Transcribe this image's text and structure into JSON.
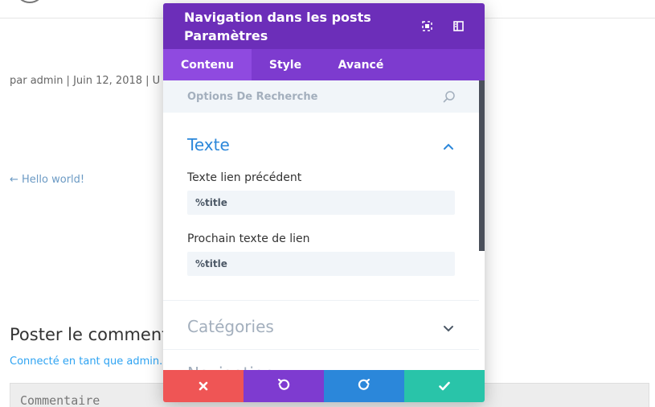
{
  "background": {
    "meta": "par admin | Juin 12, 2018 | U",
    "prev_link": "← Hello world!",
    "comment_heading": "Poster le comment",
    "logged_in": "Connecté en tant que admin.",
    "comment_placeholder": "Commentaire"
  },
  "modal": {
    "title": "Navigation dans les posts Paramètres",
    "header_icons": [
      "expand-icon",
      "split-view-icon"
    ],
    "tabs": [
      {
        "label": "Contenu",
        "active": true
      },
      {
        "label": "Style",
        "active": false
      },
      {
        "label": "Avancé",
        "active": false
      }
    ],
    "search": {
      "placeholder": "Options De Recherche"
    },
    "sections": {
      "texte": {
        "title": "Texte",
        "fields": [
          {
            "label": "Texte lien précédent",
            "value": "%title"
          },
          {
            "label": "Prochain texte de lien",
            "value": "%title"
          }
        ]
      },
      "categories": {
        "title": "Catégories"
      },
      "navigation": {
        "title": "Navigation"
      }
    },
    "footer_buttons": [
      "close-icon",
      "undo-icon",
      "redo-icon",
      "check-icon"
    ]
  },
  "colors": {
    "header": "#6c2eb9",
    "tabs": "#7d3bcf",
    "active_tab": "#8f4ae0",
    "accent_blue": "#2b87da",
    "close": "#ef5555",
    "undo": "#7e3bd0",
    "redo": "#2b87da",
    "save": "#29c4a9"
  }
}
